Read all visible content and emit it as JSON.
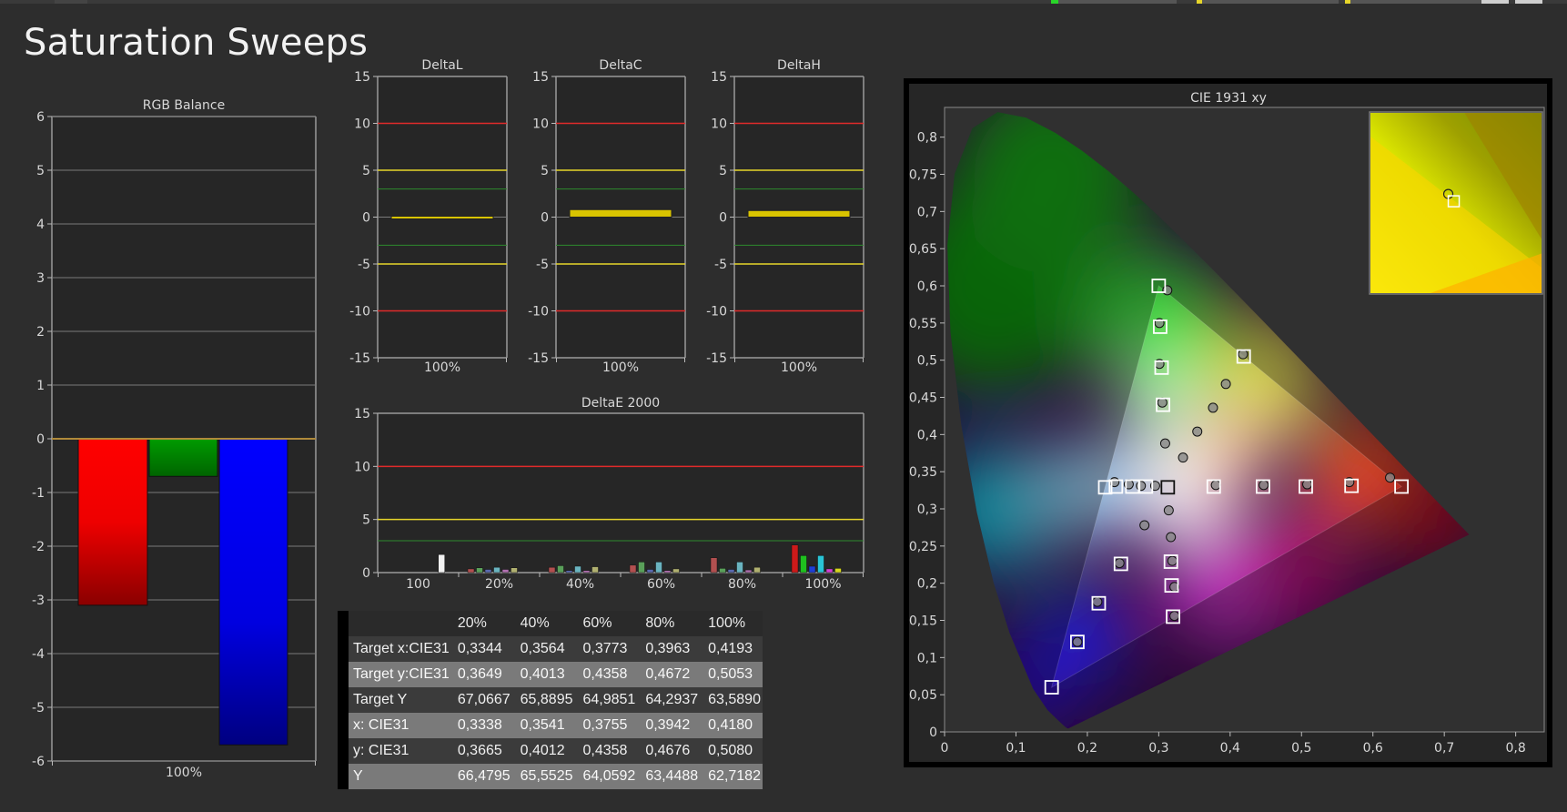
{
  "page_title": "Saturation Sweeps",
  "colors": {
    "background": "#2d2d2d",
    "plot_bg": "#262626",
    "red_limit": "#e02a2a",
    "yellow_limit": "#e6d52a",
    "green_limit": "#2e8b2e"
  },
  "chart_data": [
    {
      "type": "bar",
      "title": "RGB Balance",
      "categories": [
        "100%"
      ],
      "series": [
        {
          "color": "#ff0000",
          "values": [
            -3.1
          ]
        },
        {
          "color": "#009900",
          "values": [
            -0.7
          ]
        },
        {
          "color": "#0000ff",
          "values": [
            -5.7
          ]
        }
      ],
      "y_ticks": [
        "6",
        "5",
        "4",
        "3",
        "2",
        "1",
        "0",
        "-1",
        "-2",
        "-3",
        "-4",
        "-5",
        "-6"
      ],
      "ylim": [
        -6,
        6
      ],
      "grid": true
    },
    {
      "type": "bar",
      "title": "DeltaL",
      "categories": [
        "100%"
      ],
      "values": [
        -0.05
      ],
      "ylim": [
        -15,
        15
      ],
      "y_ticks": [
        "15",
        "10",
        "5",
        "0",
        "-5",
        "-10",
        "-15"
      ],
      "limits": [
        10,
        5,
        3,
        -3,
        -5,
        -10
      ]
    },
    {
      "type": "bar",
      "title": "DeltaC",
      "categories": [
        "100%"
      ],
      "values": [
        0.8
      ],
      "ylim": [
        -15,
        15
      ],
      "y_ticks": [
        "15",
        "10",
        "5",
        "0",
        "-5",
        "-10",
        "-15"
      ],
      "limits": [
        10,
        5,
        3,
        -3,
        -5,
        -10
      ]
    },
    {
      "type": "bar",
      "title": "DeltaH",
      "categories": [
        "100%"
      ],
      "values": [
        0.7
      ],
      "ylim": [
        -15,
        15
      ],
      "y_ticks": [
        "15",
        "10",
        "5",
        "0",
        "-5",
        "-10",
        "-15"
      ],
      "limits": [
        10,
        5,
        3,
        -3,
        -5,
        -10
      ]
    },
    {
      "type": "bar",
      "title": "DeltaE 2000",
      "categories": [
        "100",
        "20%",
        "40%",
        "60%",
        "80%",
        "100%"
      ],
      "colors": [
        "#cc1a1a",
        "#1fc11f",
        "#1f3fd6",
        "#29c4d6",
        "#d63fd6",
        "#d6d61f"
      ],
      "white_value": 1.7,
      "groups": [
        [
          0.35,
          0.45,
          0.3,
          0.5,
          0.3,
          0.45
        ],
        [
          0.5,
          0.65,
          0.2,
          0.6,
          0.2,
          0.55
        ],
        [
          0.7,
          1.0,
          0.3,
          1.0,
          0.2,
          0.35
        ],
        [
          1.4,
          0.4,
          0.3,
          1.0,
          0.25,
          0.5
        ],
        [
          2.6,
          1.6,
          0.6,
          1.6,
          0.35,
          0.4
        ]
      ],
      "ylim": [
        0,
        15
      ],
      "y_ticks": [
        "15",
        "10",
        "5",
        "0"
      ],
      "limits": [
        10,
        5,
        3
      ]
    },
    {
      "type": "scatter",
      "title": "CIE 1931 xy",
      "xlim": [
        0,
        0.84
      ],
      "ylim": [
        0,
        0.84
      ],
      "x_ticks": [
        "0",
        "0,1",
        "0,2",
        "0,3",
        "0,4",
        "0,5",
        "0,6",
        "0,7",
        "0,8"
      ],
      "y_ticks": [
        "0,8",
        "0,75",
        "0,7",
        "0,65",
        "0,6",
        "0,55",
        "0,5",
        "0,45",
        "0,4",
        "0,35",
        "0,3",
        "0,25",
        "0,2",
        "0,15",
        "0,1",
        "0,05",
        "0"
      ],
      "gamut": {
        "red": [
          0.64,
          0.33
        ],
        "green": [
          0.3,
          0.6
        ],
        "blue": [
          0.15,
          0.06
        ],
        "white": [
          0.3127,
          0.329
        ]
      },
      "targets": [
        [
          0.64,
          0.33
        ],
        [
          0.57,
          0.331
        ],
        [
          0.506,
          0.33
        ],
        [
          0.446,
          0.33
        ],
        [
          0.377,
          0.33
        ],
        [
          0.3,
          0.6
        ],
        [
          0.302,
          0.545
        ],
        [
          0.304,
          0.49
        ],
        [
          0.306,
          0.44
        ],
        [
          0.419,
          0.505
        ],
        [
          0.15,
          0.06
        ],
        [
          0.186,
          0.121
        ],
        [
          0.216,
          0.173
        ],
        [
          0.247,
          0.226
        ],
        [
          0.32,
          0.155
        ],
        [
          0.318,
          0.197
        ],
        [
          0.317,
          0.229
        ],
        [
          0.3127,
          0.329
        ],
        [
          0.225,
          0.329
        ],
        [
          0.24,
          0.33
        ],
        [
          0.263,
          0.33
        ],
        [
          0.282,
          0.33
        ]
      ],
      "measured": [
        [
          0.624,
          0.342
        ],
        [
          0.567,
          0.336
        ],
        [
          0.508,
          0.333
        ],
        [
          0.447,
          0.332
        ],
        [
          0.38,
          0.332
        ],
        [
          0.312,
          0.594
        ],
        [
          0.301,
          0.55
        ],
        [
          0.301,
          0.495
        ],
        [
          0.305,
          0.443
        ],
        [
          0.309,
          0.388
        ],
        [
          0.418,
          0.508
        ],
        [
          0.394,
          0.468
        ],
        [
          0.376,
          0.436
        ],
        [
          0.354,
          0.404
        ],
        [
          0.334,
          0.369
        ],
        [
          0.186,
          0.121
        ],
        [
          0.214,
          0.175
        ],
        [
          0.245,
          0.227
        ],
        [
          0.28,
          0.278
        ],
        [
          0.322,
          0.156
        ],
        [
          0.322,
          0.195
        ],
        [
          0.319,
          0.23
        ],
        [
          0.317,
          0.262
        ],
        [
          0.314,
          0.298
        ],
        [
          0.238,
          0.336
        ],
        [
          0.258,
          0.333
        ],
        [
          0.275,
          0.331
        ],
        [
          0.295,
          0.331
        ]
      ],
      "zoom_inset": {
        "target": [
          0.4193,
          0.5053
        ],
        "measured": [
          0.418,
          0.508
        ]
      }
    }
  ],
  "table": {
    "headers": [
      "",
      "20%",
      "40%",
      "60%",
      "80%",
      "100%"
    ],
    "rows": [
      {
        "label": "Target x:CIE31",
        "values": [
          "0,3344",
          "0,3564",
          "0,3773",
          "0,3963",
          "0,4193"
        ]
      },
      {
        "label": "Target y:CIE31",
        "values": [
          "0,3649",
          "0,4013",
          "0,4358",
          "0,4672",
          "0,5053"
        ]
      },
      {
        "label": "Target Y",
        "values": [
          "67,0667",
          "65,8895",
          "64,9851",
          "64,2937",
          "63,5890"
        ]
      },
      {
        "label": "x: CIE31",
        "values": [
          "0,3338",
          "0,3541",
          "0,3755",
          "0,3942",
          "0,4180"
        ]
      },
      {
        "label": "y: CIE31",
        "values": [
          "0,3665",
          "0,4012",
          "0,4358",
          "0,4676",
          "0,5080"
        ]
      },
      {
        "label": "Y",
        "values": [
          "66,4795",
          "65,5525",
          "64,0592",
          "63,4488",
          "62,7182"
        ]
      }
    ]
  }
}
